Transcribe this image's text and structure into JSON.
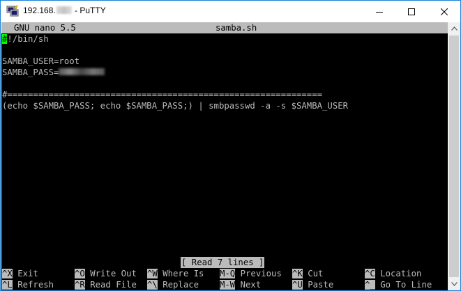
{
  "window": {
    "title_prefix": "192.168.",
    "title_suffix": " - PuTTY",
    "icon": "putty-icon"
  },
  "nano": {
    "app": "GNU nano 5.5",
    "filename": "samba.sh",
    "lines": [
      "!/bin/sh",
      "",
      "SAMBA_USER=root",
      "SAMBA_PASS=",
      "",
      "#=============================================================",
      "(echo $SAMBA_PASS; echo $SAMBA_PASS;) | smbpasswd -a -s $SAMBA_USER"
    ],
    "cursor_char": "#",
    "status": "[ Read 7 lines ]",
    "shortcuts": [
      {
        "key": "^X",
        "label": "Exit"
      },
      {
        "key": "^O",
        "label": "Write Out"
      },
      {
        "key": "^W",
        "label": "Where Is"
      },
      {
        "key": "M-Q",
        "label": "Previous"
      },
      {
        "key": "^K",
        "label": "Cut"
      },
      {
        "key": "^C",
        "label": "Location"
      },
      {
        "key": "^L",
        "label": "Refresh"
      },
      {
        "key": "^R",
        "label": "Read File"
      },
      {
        "key": "^\\",
        "label": "Replace"
      },
      {
        "key": "M-W",
        "label": "Next"
      },
      {
        "key": "^U",
        "label": "Paste"
      },
      {
        "key": "^_",
        "label": "Go To Line"
      }
    ]
  }
}
